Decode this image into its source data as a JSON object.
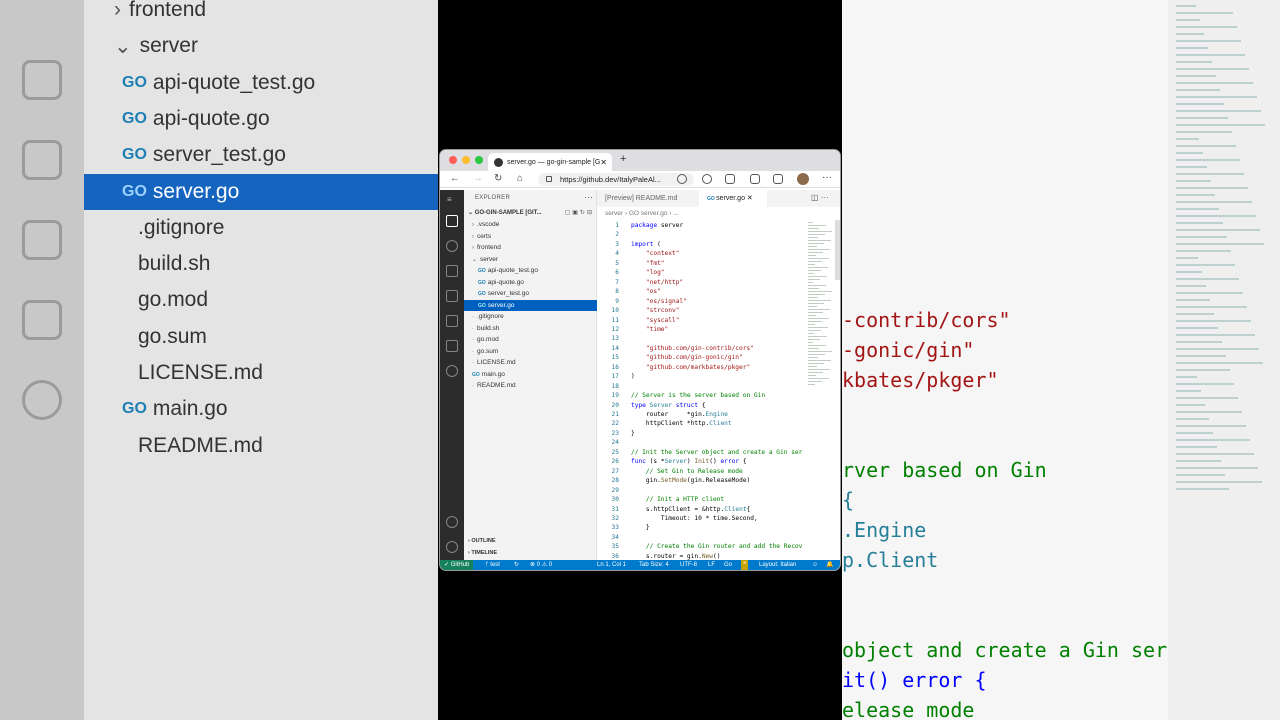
{
  "backdrop_left": {
    "rows": [
      {
        "label": "frontend",
        "chev": "›",
        "indent": false
      },
      {
        "label": "server",
        "chev": "⌄",
        "indent": false
      },
      {
        "label": "api-quote_test.go",
        "go": true
      },
      {
        "label": "api-quote.go",
        "go": true
      },
      {
        "label": "server_test.go",
        "go": true
      },
      {
        "label": "server.go",
        "go": true,
        "selected": true
      },
      {
        "label": ".gitignore"
      },
      {
        "label": "build.sh"
      },
      {
        "label": "go.mod"
      },
      {
        "label": "go.sum"
      },
      {
        "label": "LICENSE.md"
      },
      {
        "label": "main.go",
        "go": true
      },
      {
        "label": "README.md"
      }
    ]
  },
  "backdrop_right": {
    "lines": [
      "-contrib/cors\"",
      "-gonic/gin\"",
      "kbates/pkger\"",
      "rver based on Gin",
      "{",
      ".Engine",
      "p.Client",
      "object and create a Gin ser",
      "it() error {",
      "elease mode"
    ]
  },
  "browser": {
    "tab_title": "server.go — go-gin-sample [G",
    "url": "https://github.dev/ItalyPaleAl..."
  },
  "vscode": {
    "explorer_title": "EXPLORER",
    "repo": "GO-GIN-SAMPLE [GIT...",
    "tree": [
      {
        "label": ".vscode",
        "chev": "›",
        "indent": 1
      },
      {
        "label": "certs",
        "chev": "›",
        "indent": 1
      },
      {
        "label": "frontend",
        "chev": "›",
        "indent": 1
      },
      {
        "label": "server",
        "chev": "⌄",
        "indent": 1
      },
      {
        "label": "api-quote_test.go",
        "go": true,
        "indent": 2
      },
      {
        "label": "api-quote.go",
        "go": true,
        "indent": 2
      },
      {
        "label": "server_test.go",
        "go": true,
        "indent": 2
      },
      {
        "label": "server.go",
        "go": true,
        "indent": 2,
        "selected": true
      },
      {
        "label": ".gitignore",
        "indent": 1
      },
      {
        "label": "build.sh",
        "indent": 1
      },
      {
        "label": "go.mod",
        "indent": 1
      },
      {
        "label": "go.sum",
        "indent": 1
      },
      {
        "label": "LICENSE.md",
        "indent": 1
      },
      {
        "label": "main.go",
        "go": true,
        "indent": 1
      },
      {
        "label": "README.md",
        "indent": 1
      }
    ],
    "outline": "OUTLINE",
    "timeline": "TIMELINE",
    "tabs": [
      "[Preview] README.md",
      "server.go"
    ],
    "breadcrumb": "server › GO server.go › ...",
    "code": [
      "package server",
      "",
      "import (",
      "    \"context\"",
      "    \"fmt\"",
      "    \"log\"",
      "    \"net/http\"",
      "    \"os\"",
      "    \"os/signal\"",
      "    \"strconv\"",
      "    \"syscall\"",
      "    \"time\"",
      "",
      "    \"github.com/gin-contrib/cors\"",
      "    \"github.com/gin-gonic/gin\"",
      "    \"github.com/markbates/pkger\"",
      ")",
      "",
      "// Server is the server based on Gin",
      "type Server struct {",
      "    router     *gin.Engine",
      "    httpClient *http.Client",
      "}",
      "",
      "// Init the Server object and create a Gin ser",
      "func (s *Server) Init() error {",
      "    // Set Gin to Release mode",
      "    gin.SetMode(gin.ReleaseMode)",
      "",
      "    // Init a HTTP client",
      "    s.httpClient = &http.Client{",
      "        Timeout: 10 * time.Second,",
      "    }",
      "",
      "    // Create the Gin router and add the Recov",
      "    s.router = gin.New()"
    ],
    "status": {
      "github": "GitHub",
      "branch": "test",
      "problems": "⊗ 0 ⚠ 0",
      "position": "Ln 1, Col 1",
      "tab_size": "Tab Size: 4",
      "encoding": "UTF-8",
      "eol": "LF",
      "language": "Go",
      "layout": "Layout: Italian"
    }
  }
}
